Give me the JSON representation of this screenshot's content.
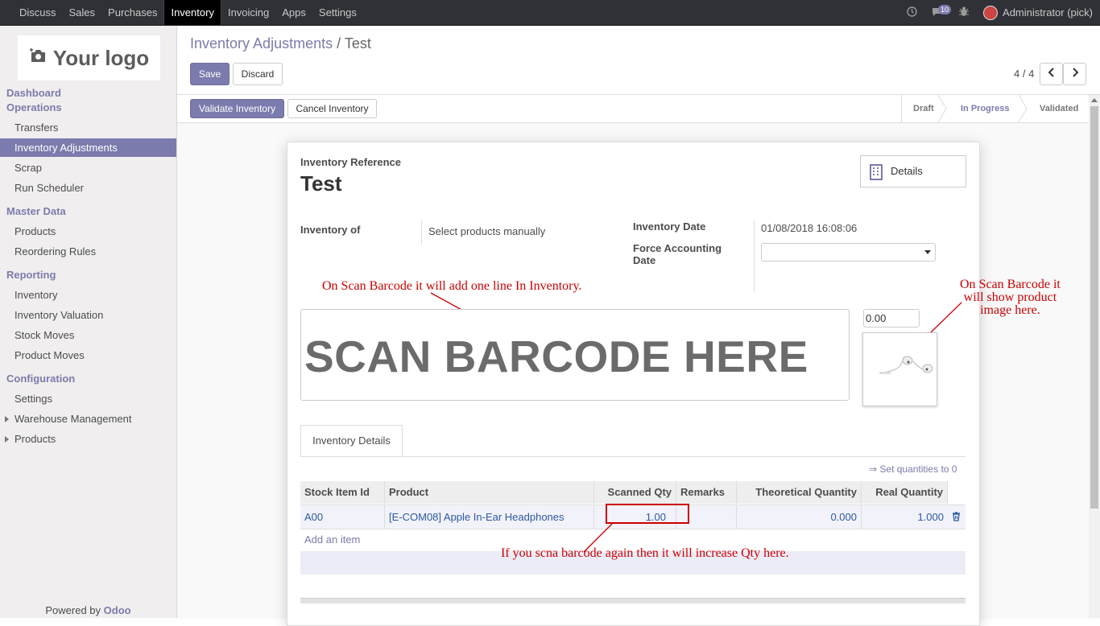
{
  "topbar": {
    "menu": [
      "Discuss",
      "Sales",
      "Purchases",
      "Inventory",
      "Invoicing",
      "Apps",
      "Settings"
    ],
    "active_menu": "Inventory",
    "chat_count": "10",
    "user": "Administrator (pick)"
  },
  "sidebar": {
    "logo_text": "Your logo",
    "sections": {
      "dashboard": "Dashboard",
      "operations": "Operations",
      "master_data": "Master Data",
      "reporting": "Reporting",
      "configuration": "Configuration"
    },
    "items": {
      "transfers": "Transfers",
      "inventory_adjustments": "Inventory Adjustments",
      "scrap": "Scrap",
      "run_scheduler": "Run Scheduler",
      "products": "Products",
      "reordering_rules": "Reordering Rules",
      "inventory": "Inventory",
      "inventory_valuation": "Inventory Valuation",
      "stock_moves": "Stock Moves",
      "product_moves": "Product Moves",
      "settings": "Settings",
      "warehouse_management": "Warehouse Management",
      "products_config": "Products"
    },
    "powered_by": "Powered by",
    "powered_brand": "Odoo"
  },
  "breadcrumb": {
    "parent": "Inventory Adjustments",
    "separator": "/",
    "current": "Test"
  },
  "buttons": {
    "save": "Save",
    "discard": "Discard",
    "validate": "Validate Inventory",
    "cancel": "Cancel Inventory",
    "details": "Details"
  },
  "pager": {
    "value": "4 / 4"
  },
  "stages": {
    "draft": "Draft",
    "in_progress": "In Progress",
    "validated": "Validated"
  },
  "form": {
    "reference_label": "Inventory Reference",
    "reference": "Test",
    "inventory_of_label": "Inventory of",
    "inventory_of": "Select products manually",
    "date_label": "Inventory Date",
    "date": "01/08/2018 16:08:06",
    "force_label_1": "Force Accounting",
    "force_label_2": "Date",
    "scan_placeholder": "SCAN BARCODE HERE",
    "qty": "0.00"
  },
  "annotations": {
    "a1": "On Scan Barcode it will add one line In Inventory.",
    "a2_l1": "On Scan Barcode it",
    "a2_l2": "will show product",
    "a2_l3": "image here.",
    "a3": "If you scna barcode again then it will increase Qty here."
  },
  "tab": {
    "label": "Inventory Details"
  },
  "set_qty_link": "⇒ Set quantities to 0",
  "table": {
    "headers": [
      "Stock Item Id",
      "Product",
      "Scanned Qty",
      "Remarks",
      "Theoretical Quantity",
      "Real Quantity"
    ],
    "row": {
      "stock_item_id": "A00",
      "product": "[E-COM08] Apple In-Ear Headphones",
      "scanned_qty": "1.00",
      "remarks": "",
      "theoretical_qty": "0.000",
      "real_qty": "1.000"
    },
    "add_item": "Add an item"
  },
  "colors": {
    "brand": "#7c7bad",
    "annotation": "#cc0000"
  }
}
